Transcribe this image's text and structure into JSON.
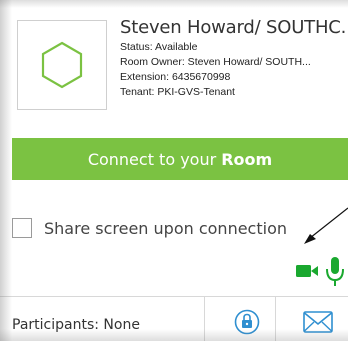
{
  "profile": {
    "name": "Steven Howard/ SOUTHC...",
    "status": "Status: Available",
    "room_owner": "Room Owner: Steven Howard/ SOUTH...",
    "extension": "Extension: 6435670998",
    "tenant": "Tenant: PKI-GVS-Tenant",
    "avatar_icon": "hexagon-icon"
  },
  "connect": {
    "label_prefix": "Connect to your",
    "label_bold": "Room",
    "color": "#7bc242"
  },
  "share": {
    "label": "Share screen upon connection",
    "checked": false
  },
  "media": {
    "camera_icon": "camera-icon",
    "mic_icon": "microphone-icon",
    "color": "#1aa82f"
  },
  "footer": {
    "participants": "Participants: None",
    "lock_icon": "lock-icon",
    "invite_icon": "envelope-icon",
    "icon_color": "#2f8fd0"
  }
}
